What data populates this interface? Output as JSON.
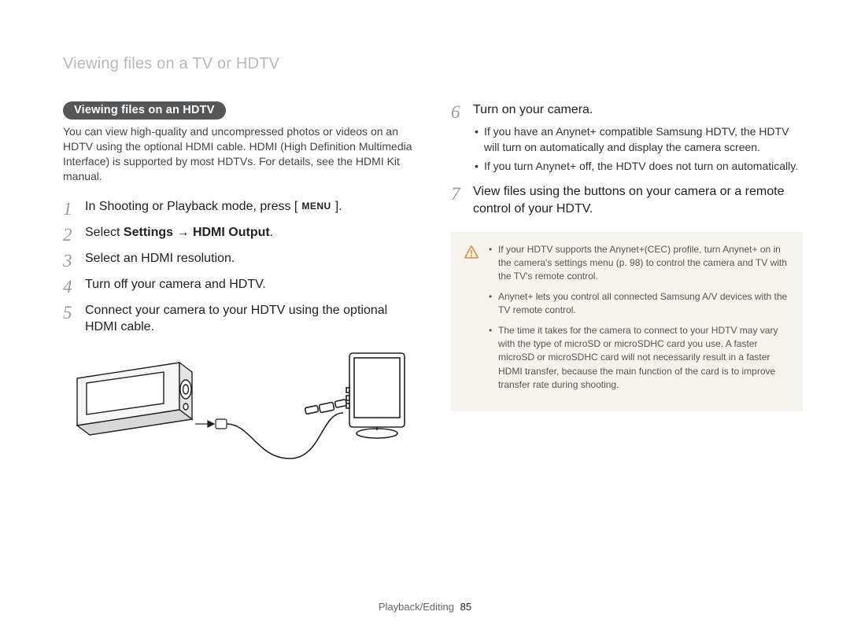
{
  "header": "Viewing files on a TV or HDTV",
  "section_title": "Viewing files on an HDTV",
  "intro": "You can view high-quality and uncompressed photos or videos on an HDTV using the optional HDMI cable. HDMI (High Definition Multimedia Interface) is supported by most HDTVs. For details, see the HDMI Kit manual.",
  "steps": {
    "1": {
      "pre": "In Shooting or Playback mode, press [",
      "menu": "MENU",
      "post": "]."
    },
    "2": {
      "pre": "Select ",
      "bold1": "Settings",
      "arrow": " → ",
      "bold2": "HDMI Output",
      "post": "."
    },
    "3": {
      "text": "Select an HDMI resolution."
    },
    "4": {
      "text": "Turn off your camera and HDTV."
    },
    "5": {
      "text": "Connect your camera to your HDTV using the optional HDMI cable."
    },
    "6": {
      "text": "Turn on your camera.",
      "subs": [
        "If you have an Anynet+ compatible Samsung HDTV, the HDTV will turn on automatically and display the camera screen.",
        "If you turn Anynet+ off, the HDTV does not turn on automatically."
      ]
    },
    "7": {
      "text": "View files using the buttons on your camera or a remote control of your HDTV."
    }
  },
  "notes": [
    "If your HDTV supports the Anynet+(CEC) profile, turn Anynet+ on in the camera's settings menu (p. 98) to control the camera and TV with the TV's remote control.",
    "Anynet+ lets you control all connected Samsung A/V devices with the TV remote control.",
    "The time it takes for the camera to connect to your HDTV may vary with the type of microSD or microSDHC card you use. A faster microSD or microSDHC card will not necessarily result in a faster HDMI transfer, because the main function of the card is to improve transfer rate during shooting."
  ],
  "footer": {
    "section": "Playback/Editing",
    "page": "85"
  }
}
